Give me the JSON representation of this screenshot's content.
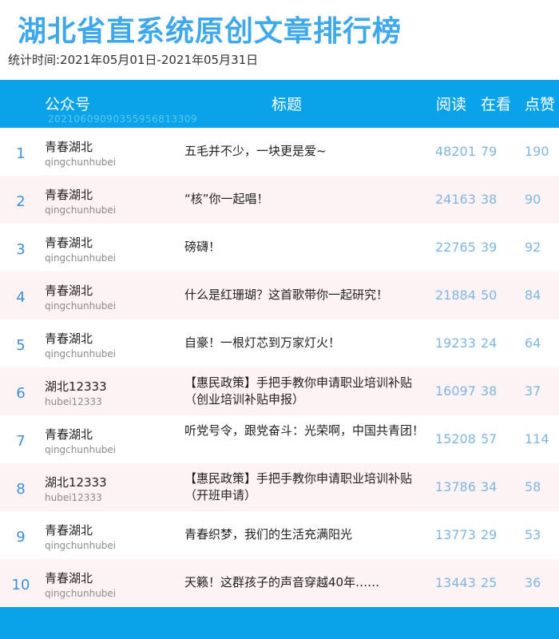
{
  "page": {
    "title": "湖北省直系统原创文章排行榜",
    "period": "统计时间:2021年05月01日-2021年05月31日"
  },
  "table": {
    "headers": {
      "account": "公众号",
      "title": "标题",
      "reads": "阅读",
      "viewing": "在看",
      "likes": "点赞"
    },
    "id_code": "20210609090355956813309",
    "rows": [
      {
        "rank": "1",
        "name": "青春湖北",
        "id": "qingchunhubei",
        "title": "五毛并不少，一块更是爱~",
        "reads": "48201",
        "viewing": "79",
        "likes": "190"
      },
      {
        "rank": "2",
        "name": "青春湖北",
        "id": "qingchunhubei",
        "title": "“核”你一起唱！",
        "reads": "24163",
        "viewing": "38",
        "likes": "90"
      },
      {
        "rank": "3",
        "name": "青春湖北",
        "id": "qingchunhubei",
        "title": "磅礴！",
        "reads": "22765",
        "viewing": "39",
        "likes": "92"
      },
      {
        "rank": "4",
        "name": "青春湖北",
        "id": "qingchunhubei",
        "title": "什么是红珊瑚？这首歌带你一起研究！",
        "reads": "21884",
        "viewing": "50",
        "likes": "84"
      },
      {
        "rank": "5",
        "name": "青春湖北",
        "id": "qingchunhubei",
        "title": "自豪！一根灯芯到万家灯火！",
        "reads": "19233",
        "viewing": "24",
        "likes": "64"
      },
      {
        "rank": "6",
        "name": "湖北12333",
        "id": "hubei12333",
        "title": "【惠民政策】手把手教你申请职业培训补贴（创业培训补贴申报）",
        "reads": "16097",
        "viewing": "38",
        "likes": "37"
      },
      {
        "rank": "7",
        "name": "青春湖北",
        "id": "qingchunhubei",
        "title": "听党号令，跟党奋斗：光荣啊，中国共青团！",
        "reads": "15208",
        "viewing": "57",
        "likes": "114"
      },
      {
        "rank": "8",
        "name": "湖北12333",
        "id": "hubei12333",
        "title": "【惠民政策】手把手教你申请职业培训补贴（开班申请）",
        "reads": "13786",
        "viewing": "34",
        "likes": "58"
      },
      {
        "rank": "9",
        "name": "青春湖北",
        "id": "qingchunhubei",
        "title": "青春织梦，我们的生活充满阳光",
        "reads": "13773",
        "viewing": "29",
        "likes": "53"
      },
      {
        "rank": "10",
        "name": "青春湖北",
        "id": "qingchunhubei",
        "title": "天籁！这群孩子的声音穿越40年……",
        "reads": "13443",
        "viewing": "25",
        "likes": "36"
      }
    ]
  },
  "colors": {
    "title": "#3ea8ea",
    "header_bg": "#0aa3ea",
    "alt_row_bg": "#fdf3f4",
    "rank": "#3d8fd6",
    "numbers": "#7fb6e2"
  }
}
